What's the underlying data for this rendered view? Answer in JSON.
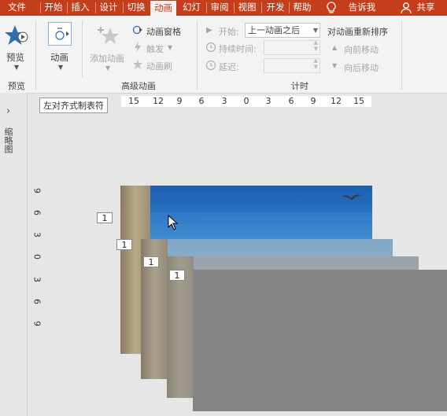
{
  "tabs": [
    "文件",
    "开始",
    "插入",
    "设计",
    "切换",
    "动画",
    "幻灯",
    "审阅",
    "视图",
    "开发",
    "帮助"
  ],
  "active_tab": "动画",
  "tell_me": "告诉我",
  "share": "共享",
  "ribbon": {
    "preview": {
      "button": "预览",
      "group": "预览"
    },
    "animation": {
      "button": "动画"
    },
    "advanced": {
      "add_animation": "添加动画",
      "animation_pane": "动画窗格",
      "trigger": "触发",
      "painter": "动画刷",
      "group": "高级动画"
    },
    "timing": {
      "start_label": "开始:",
      "start_value": "上一动画之后",
      "duration_label": "持续时间:",
      "delay_label": "延迟:",
      "group": "计时"
    },
    "reorder": {
      "title": "对动画重新排序",
      "move_earlier": "向前移动",
      "move_later": "向后移动"
    }
  },
  "left_pane": {
    "label": "缩略图"
  },
  "tooltip": "左对齐式制表符",
  "ruler_h": [
    "15",
    "12",
    "9",
    "6",
    "3",
    "0",
    "3",
    "6",
    "9",
    "12",
    "15"
  ],
  "ruler_v": [
    "9",
    "6",
    "3",
    "0",
    "3",
    "6",
    "9"
  ],
  "animation_tags": [
    "1",
    "1",
    "1",
    "1"
  ],
  "colors": {
    "accent": "#c43e1c",
    "ribbon": "#f3f3f3",
    "canvas": "#e6e6e6",
    "gray_slide": "#858585"
  }
}
